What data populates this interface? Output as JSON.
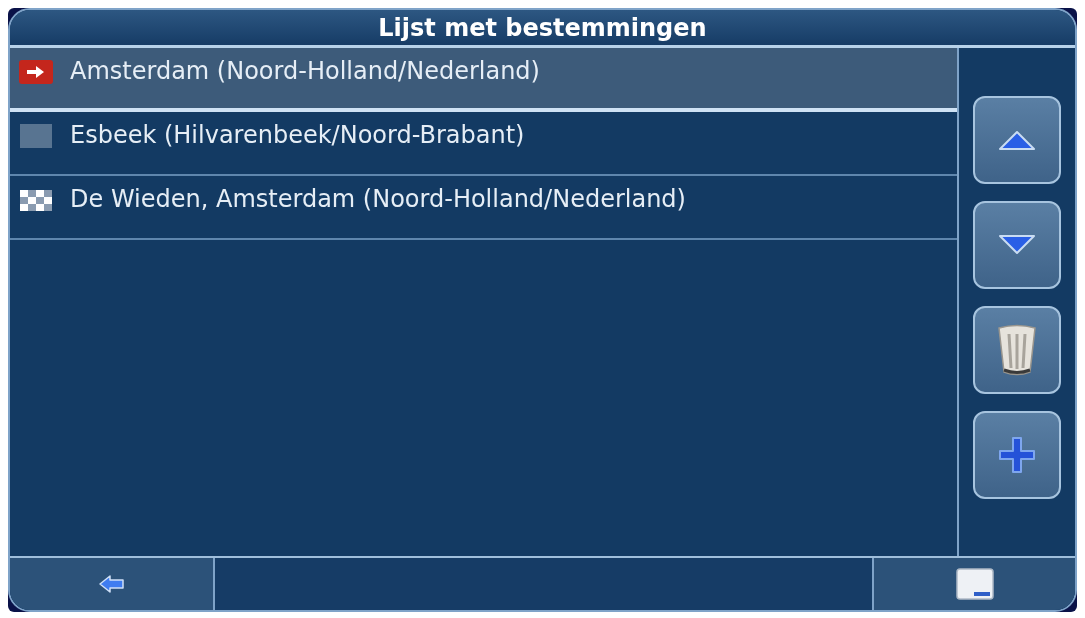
{
  "title": "Lijst met bestemmingen",
  "destinations": [
    {
      "kind": "current",
      "label": "Amsterdam (Noord-Holland/Nederland)",
      "selected": true
    },
    {
      "kind": "via",
      "label": "Esbeek (Hilvarenbeek/Noord-Brabant)",
      "selected": false
    },
    {
      "kind": "finish",
      "label": "De Wieden, Amsterdam (Noord-Holland/Nederland)",
      "selected": false
    }
  ],
  "side_buttons": [
    {
      "kind": "up"
    },
    {
      "kind": "down"
    },
    {
      "kind": "delete"
    },
    {
      "kind": "add"
    }
  ],
  "bottom_bar": {
    "left_button": {
      "kind": "back"
    },
    "right_button": {
      "kind": "view"
    }
  }
}
